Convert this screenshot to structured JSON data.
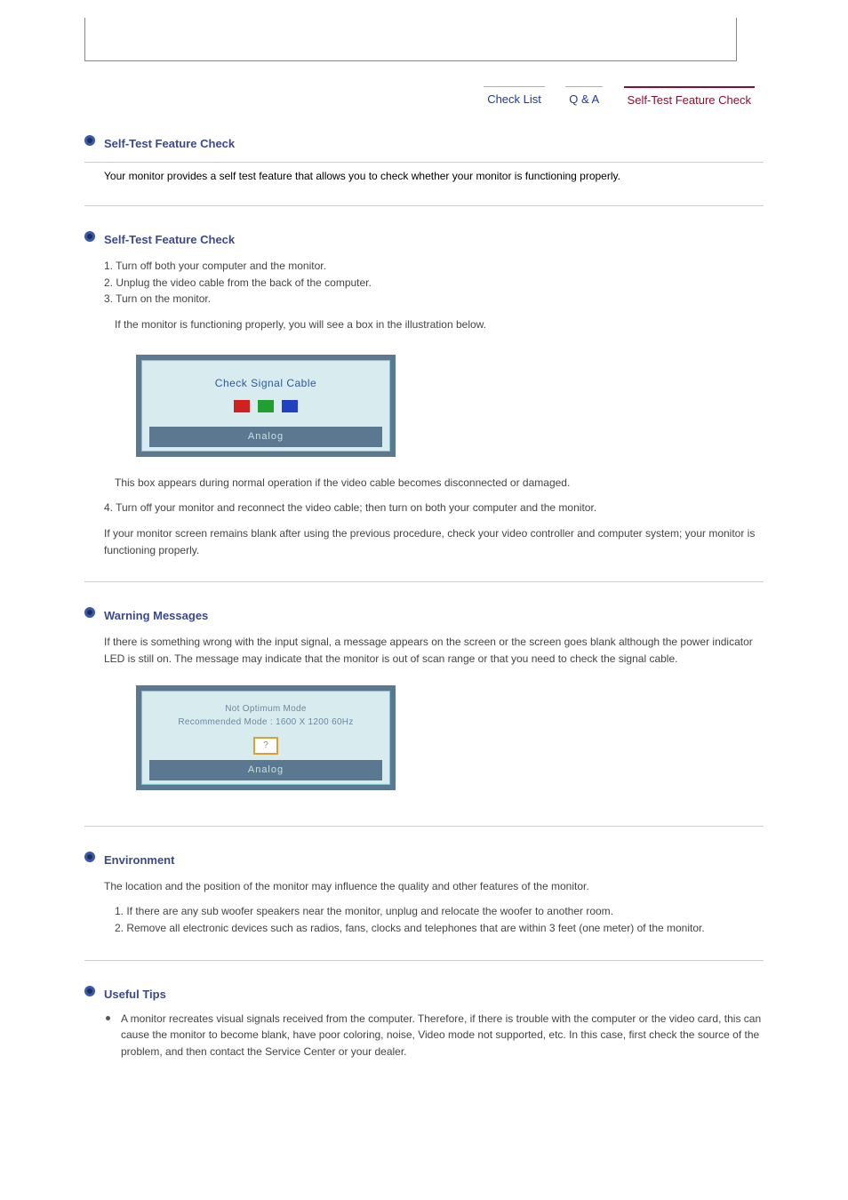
{
  "tabs": {
    "check_list": "Check List",
    "qa": "Q & A",
    "self_test": "Self-Test Feature Check"
  },
  "sections": {
    "s1": {
      "title": "Self-Test Feature Check",
      "p1": "Your monitor provides a self test feature that allows you to check whether your monitor is functioning properly."
    },
    "s2": {
      "title": "Self-Test Feature Check",
      "step1": "1. Turn off both your computer and the monitor.",
      "step2": "2. Unplug the video cable from the back of the computer.",
      "step3": "3. Turn on the monitor.",
      "intro": "If the monitor is functioning properly, you will see a box in the illustration below.",
      "osd_title": "Check Signal Cable",
      "osd_mode": "Analog",
      "after1": "This box appears during normal operation if the video cable becomes disconnected or damaged.",
      "step4": "4. Turn off your monitor and reconnect the video cable; then turn on both your computer and the monitor.",
      "after2": "If your monitor screen remains blank after using the previous procedure, check your video controller and computer system; your monitor is functioning properly."
    },
    "s3": {
      "title": "Warning Messages",
      "p1": "If there is something wrong with the input signal, a message appears on the screen or the screen goes blank although the power indicator LED is still on. The message may indicate that the monitor is out of scan range or that you need to check the signal cable.",
      "osd_line1": "Not Optimum Mode",
      "osd_line2": "Recommended Mode : 1600 X 1200 60Hz",
      "osd_q": "?",
      "osd_mode": "Analog"
    },
    "s4": {
      "title": "Environment",
      "p1": "The location and the position of the monitor may influence the quality and other features of the monitor.",
      "li1": "1. If there are any sub woofer speakers near the monitor, unplug and relocate the woofer to another room.",
      "li2": "2. Remove all electronic devices such as radios, fans, clocks and telephones that are within 3 feet (one meter) of the monitor."
    },
    "s5": {
      "title": "Useful Tips",
      "li1": "A monitor recreates visual signals received from the computer. Therefore, if there is trouble with the computer or the video card, this can cause the monitor to become blank, have poor coloring, noise, Video mode not supported, etc. In this case, first check the source of the problem, and then contact the Service Center or your dealer."
    }
  }
}
